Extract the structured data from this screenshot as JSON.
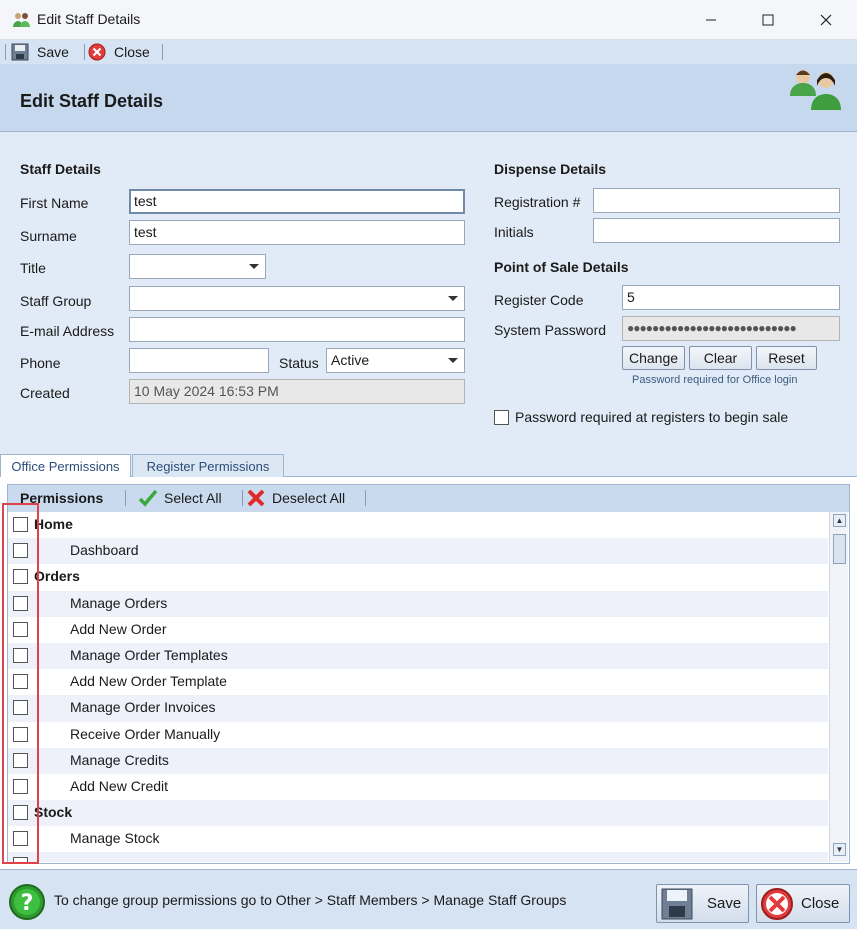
{
  "window": {
    "title": "Edit Staff Details"
  },
  "toolbar": {
    "save_label": "Save",
    "close_label": "Close"
  },
  "header": {
    "title": "Edit Staff Details"
  },
  "staff": {
    "section_title": "Staff Details",
    "first_name_label": "First Name",
    "first_name": "test",
    "surname_label": "Surname",
    "surname": "test",
    "title_label": "Title",
    "title_value": "",
    "staff_group_label": "Staff Group",
    "staff_group_value": "",
    "email_label": "E-mail Address",
    "email": "",
    "phone_label": "Phone",
    "phone": "",
    "status_label": "Status",
    "status_value": "Active",
    "created_label": "Created",
    "created": "10 May 2024 16:53 PM"
  },
  "dispense": {
    "section_title": "Dispense Details",
    "registration_label": "Registration #",
    "registration": "",
    "initials_label": "Initials",
    "initials": ""
  },
  "pos": {
    "section_title": "Point of Sale Details",
    "register_code_label": "Register Code",
    "register_code": "5",
    "system_password_label": "System Password",
    "system_password": "●●●●●●●●●●●●●●●●●●●●●●●●●●●",
    "change_label": "Change",
    "clear_label": "Clear",
    "reset_label": "Reset",
    "password_hint": "Password required for Office login",
    "register_pwd_label": "Password required at registers to begin sale"
  },
  "tabs": [
    {
      "label": "Office Permissions"
    },
    {
      "label": "Register Permissions"
    }
  ],
  "permissions": {
    "title": "Permissions",
    "select_all_label": "Select All",
    "deselect_all_label": "Deselect All",
    "items": [
      {
        "label": "Home",
        "level": 0
      },
      {
        "label": "Dashboard",
        "level": 1
      },
      {
        "label": "Orders",
        "level": 0
      },
      {
        "label": "Manage Orders",
        "level": 1
      },
      {
        "label": "Add New Order",
        "level": 1
      },
      {
        "label": "Manage Order Templates",
        "level": 1
      },
      {
        "label": "Add New Order Template",
        "level": 1
      },
      {
        "label": "Manage Order Invoices",
        "level": 1
      },
      {
        "label": "Receive Order Manually",
        "level": 1
      },
      {
        "label": "Manage Credits",
        "level": 1
      },
      {
        "label": "Add New Credit",
        "level": 1
      },
      {
        "label": "Stock",
        "level": 0
      },
      {
        "label": "Manage Stock",
        "level": 1
      },
      {
        "label": "",
        "level": 1
      }
    ]
  },
  "footer": {
    "message": "To change group permissions go to Other > Staff Members > Manage Staff Groups",
    "save_label": "Save",
    "close_label": "Close"
  }
}
